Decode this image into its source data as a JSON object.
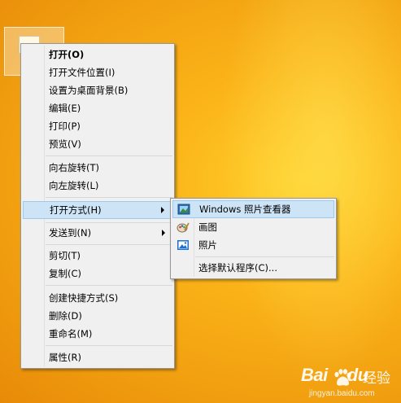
{
  "main_menu": {
    "items": [
      {
        "label": "打开(O)"
      },
      {
        "label": "打开文件位置(I)"
      },
      {
        "label": "设置为桌面背景(B)"
      },
      {
        "label": "编辑(E)"
      },
      {
        "label": "打印(P)"
      },
      {
        "label": "预览(V)"
      },
      {
        "label": "向右旋转(T)"
      },
      {
        "label": "向左旋转(L)"
      },
      {
        "label": "打开方式(H)"
      },
      {
        "label": "发送到(N)"
      },
      {
        "label": "剪切(T)"
      },
      {
        "label": "复制(C)"
      },
      {
        "label": "创建快捷方式(S)"
      },
      {
        "label": "删除(D)"
      },
      {
        "label": "重命名(M)"
      },
      {
        "label": "属性(R)"
      }
    ]
  },
  "sub_menu": {
    "items": [
      {
        "label": "Windows 照片查看器",
        "icon": "photo-viewer-icon"
      },
      {
        "label": "画图",
        "icon": "paint-icon"
      },
      {
        "label": "照片",
        "icon": "photos-icon"
      },
      {
        "label": "选择默认程序(C)..."
      }
    ]
  },
  "watermark": {
    "logo": "Bai",
    "logo_suffix": "du",
    "text": "经验",
    "url": "jingyan.baidu.com"
  },
  "colors": {
    "desktop": "#f5a914",
    "menu_bg": "#f0f0f0",
    "highlight": "#cde4f7"
  }
}
